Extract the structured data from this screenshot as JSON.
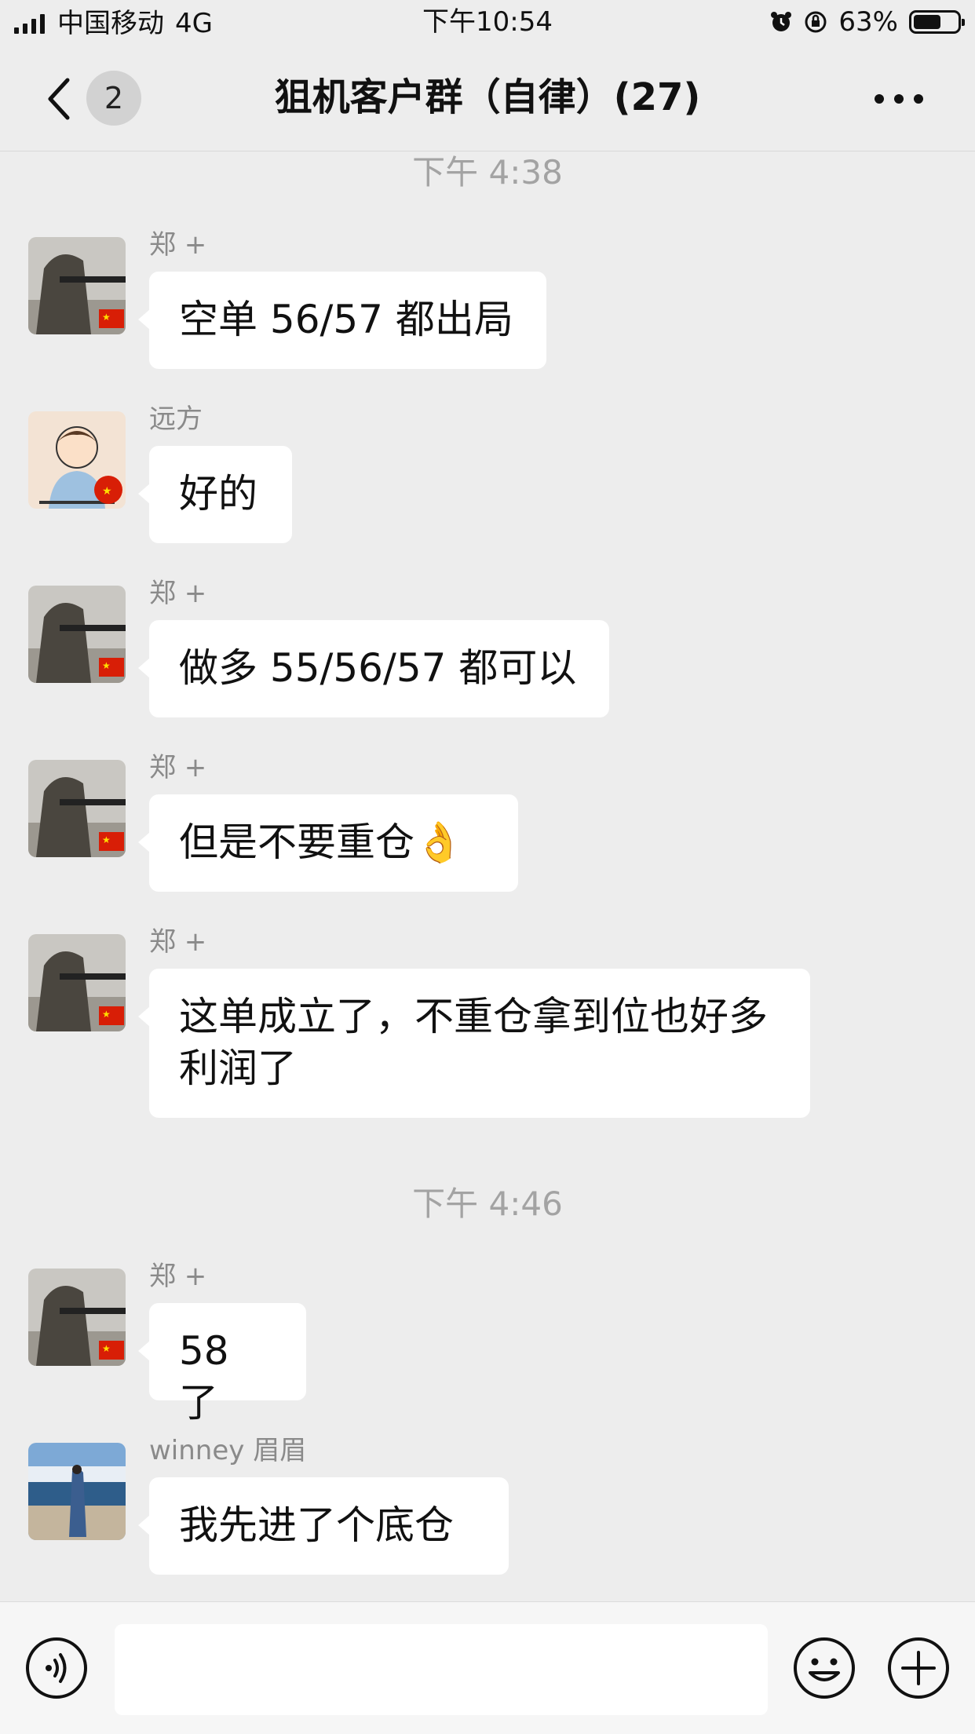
{
  "status_bar": {
    "carrier": "中国移动",
    "network": "4G",
    "time": "下午10:54",
    "battery": "63%",
    "battery_level": 0.63
  },
  "nav": {
    "back_icon": "chevron-left-icon",
    "unread_count": "2",
    "title": "狙机客户群（自律）(27)",
    "more_icon": "more-dots-icon"
  },
  "chat": {
    "timestamps": [
      "下午 4:38",
      "下午 4:46"
    ],
    "messages": [
      {
        "sender": "郑 +",
        "text": "空单 56/57 都出局"
      },
      {
        "sender": "远方",
        "text": "好的"
      },
      {
        "sender": "郑 +",
        "text": "做多 55/56/57 都可以"
      },
      {
        "sender": "郑 +",
        "text": "但是不要重仓👌"
      },
      {
        "sender": "郑 +",
        "text": "这单成立了，不重仓拿到位也好多利润了"
      },
      {
        "sender": "郑 +",
        "text": "58 了"
      },
      {
        "sender": "winney 眉眉",
        "text": "我先进了个底仓"
      }
    ]
  },
  "input_bar": {
    "voice_icon": "voice-icon",
    "emoji_icon": "emoji-icon",
    "plus_icon": "plus-icon",
    "text_value": ""
  }
}
